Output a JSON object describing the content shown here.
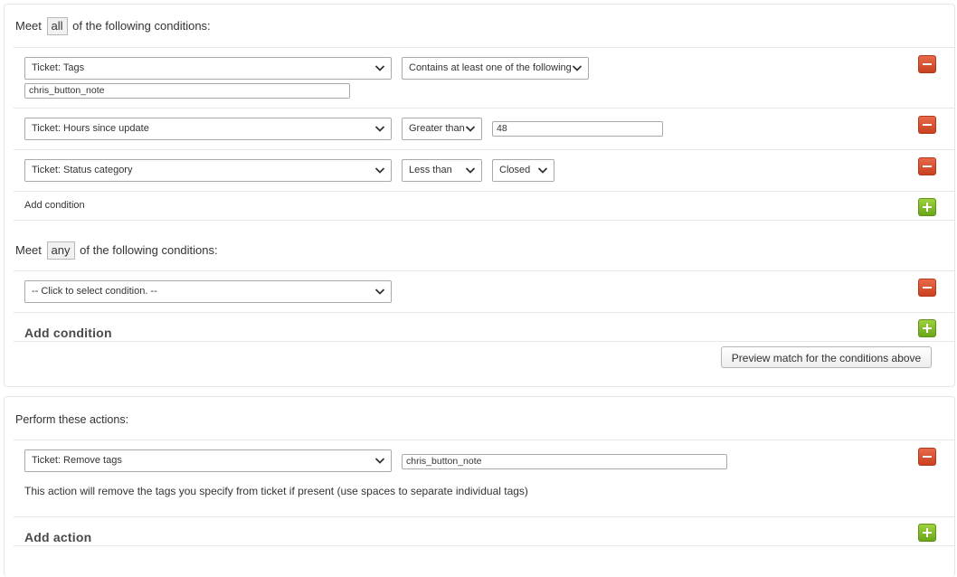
{
  "conditions_all": {
    "meet": "Meet",
    "qualifier": "all",
    "suffix": "of the following conditions:",
    "rows": [
      {
        "field": "Ticket: Tags",
        "operator": "Contains at least one of the following",
        "value": "chris_button_note"
      },
      {
        "field": "Ticket: Hours since update",
        "operator": "Greater than",
        "value": "48"
      },
      {
        "field": "Ticket: Status category",
        "operator": "Less than",
        "value": "Closed"
      }
    ],
    "add_label": "Add condition"
  },
  "conditions_any": {
    "meet": "Meet",
    "qualifier": "any",
    "suffix": "of the following conditions:",
    "rows": [
      {
        "field": "-- Click to select condition. --"
      }
    ],
    "add_label": "Add condition"
  },
  "preview_button": "Preview match for the conditions above",
  "actions": {
    "heading": "Perform these actions:",
    "rows": [
      {
        "action": "Ticket: Remove tags",
        "value": "chris_button_note",
        "description": "This action will remove the tags you specify from ticket if present (use spaces to separate individual tags)"
      }
    ],
    "add_label": "Add action"
  },
  "icons": {
    "remove": "minus-icon",
    "add": "plus-icon",
    "dropdown": "chevron-down-icon"
  },
  "colors": {
    "remove_button": "#d9502c",
    "add_button": "#82bb26",
    "border": "#e4e4e4"
  }
}
